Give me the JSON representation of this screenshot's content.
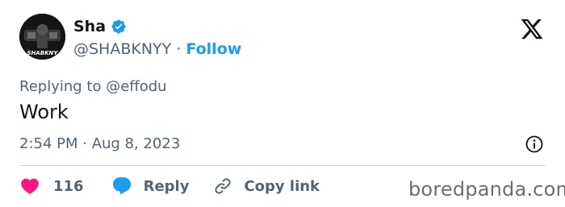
{
  "author": {
    "name": "Sha",
    "handle": "@SHABKNYY",
    "separator": "·",
    "follow_label": "Follow",
    "avatar_text": "SHABKNY"
  },
  "tweet": {
    "replying_prefix": "Replying to",
    "replying_to": "@effodu",
    "text": "Work",
    "timestamp": "2:54 PM · Aug 8, 2023"
  },
  "actions": {
    "like_count": "116",
    "reply_label": "Reply",
    "copy_link_label": "Copy link"
  },
  "watermark": "boredpanda.com",
  "colors": {
    "accent": "#1d9bf0",
    "like": "#f91880",
    "secondary_text": "#536471",
    "divider": "#cfd9de"
  },
  "icons": {
    "verified": "verified-badge-icon",
    "platform": "x-logo-icon",
    "info": "info-icon",
    "like": "heart-icon",
    "reply": "speech-bubble-icon",
    "copy_link": "link-icon"
  }
}
